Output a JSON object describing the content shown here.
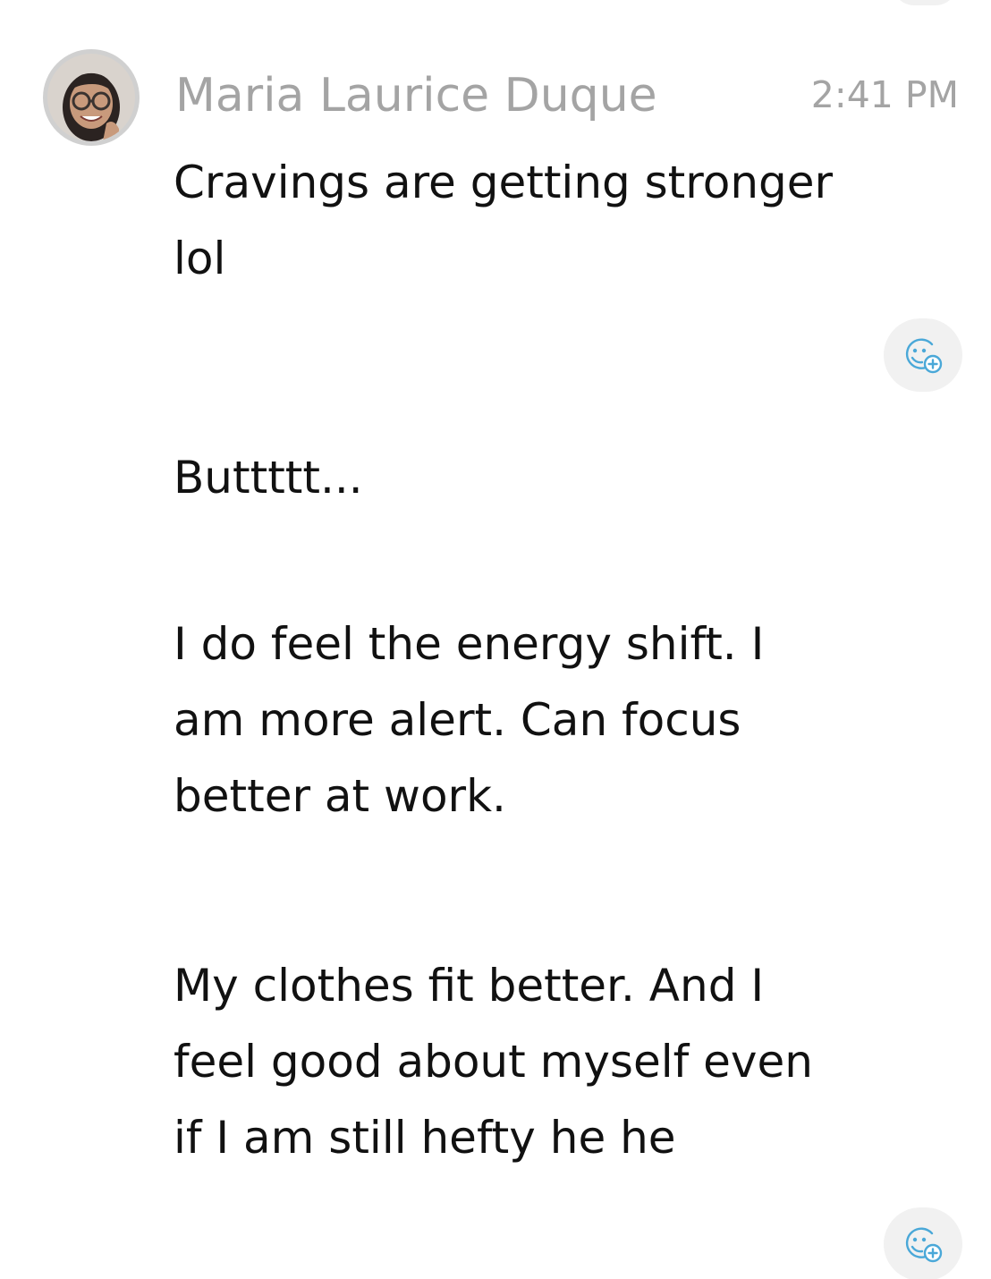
{
  "message_group": {
    "sender_name": "Maria Laurice Duque",
    "timestamp": "2:41 PM",
    "messages": [
      {
        "text": "Cravings are getting stronger\nlol"
      },
      {
        "text": "Buttttt..."
      },
      {
        "text": "I do feel the energy shift. I\nam more alert. Can focus\nbetter at work."
      },
      {
        "text": "My clothes fit better. And I\nfeel good about myself even\nif I am still hefty he he"
      }
    ]
  },
  "icons": {
    "avatar": "profile-photo",
    "reaction": "add-reaction-smiley-icon"
  },
  "colors": {
    "background": "#ffffff",
    "meta_text": "#a4a4a4",
    "body_text": "#111111",
    "reaction_bg": "#f1f1f1",
    "reaction_icon": "#4aa8d8"
  }
}
